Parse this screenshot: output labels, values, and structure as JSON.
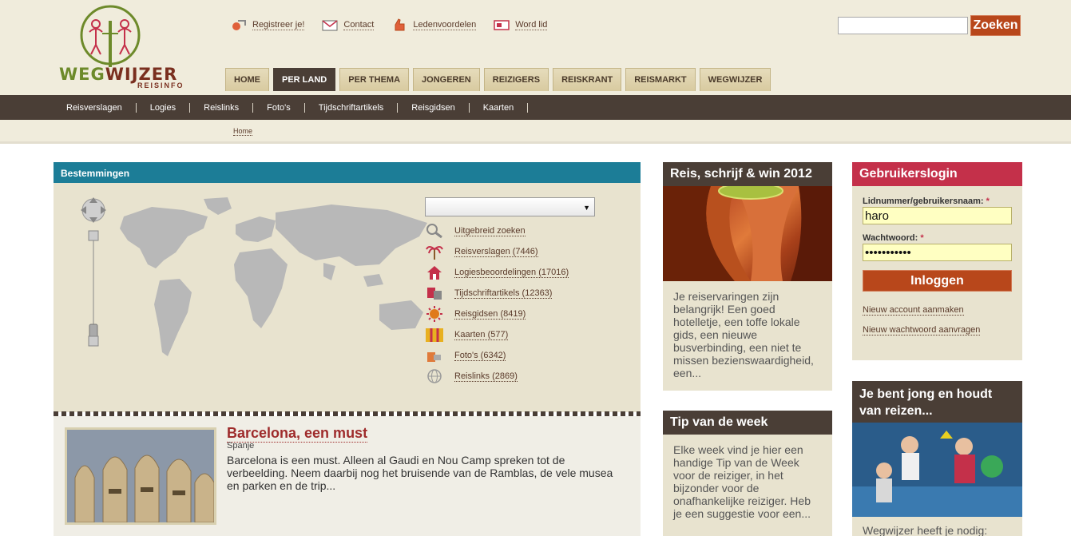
{
  "logo": {
    "word1": "WEG",
    "word2": "WIJZER",
    "sub": "REISINFO"
  },
  "toplinks": [
    {
      "label": "Registreer je!",
      "icon": "register-icon"
    },
    {
      "label": "Contact",
      "icon": "mail-icon"
    },
    {
      "label": "Ledenvoordelen",
      "icon": "thumb-icon"
    },
    {
      "label": "Word lid",
      "icon": "membership-icon"
    }
  ],
  "search": {
    "placeholder": "",
    "button": "Zoeken"
  },
  "mainnav": [
    "HOME",
    "PER LAND",
    "PER THEMA",
    "JONGEREN",
    "REIZIGERS",
    "REISKRANT",
    "REISMARKT",
    "WEGWIJZER"
  ],
  "mainnav_active": "PER LAND",
  "subnav": [
    "Reisverslagen",
    "Logies",
    "Reislinks",
    "Foto's",
    "Tijdschriftartikels",
    "Reisgidsen",
    "Kaarten"
  ],
  "breadcrumb": "Home",
  "destinations": {
    "title": "Bestemmingen",
    "select_value": "",
    "links": [
      {
        "label": "Uitgebreid zoeken",
        "icon": "magnifier-icon"
      },
      {
        "label": "Reisverslagen (7446)",
        "icon": "palm-tree-icon"
      },
      {
        "label": "Logiesbeoordelingen (17016)",
        "icon": "house-icon"
      },
      {
        "label": "Tijdschriftartikels (12363)",
        "icon": "magazine-icon"
      },
      {
        "label": "Reisgidsen (8419)",
        "icon": "sun-icon"
      },
      {
        "label": "Kaarten (577)",
        "icon": "map-icon"
      },
      {
        "label": "Foto's (6342)",
        "icon": "camera-icon"
      },
      {
        "label": "Reislinks (2869)",
        "icon": "globe-icon"
      }
    ]
  },
  "article": {
    "title": "Barcelona, een must",
    "country": "Spanje",
    "text": "Barcelona is een must. Alleen al Gaudi en Nou Camp spreken tot de verbeelding. Neem daarbij nog het bruisende van de Ramblas, de vele musea en parken en de trip..."
  },
  "reis_box": {
    "title": "Reis, schrijf & win 2012",
    "text": "Je reiservaringen zijn belangrijk! Een goed hotelletje, een toffe lokale gids, een nieuwe busverbinding, een niet te missen bezienswaardigheid, een..."
  },
  "tip_box": {
    "title": "Tip van de week",
    "text": "Elke week vind je hier een handige Tip van de Week voor de reiziger, in het bijzonder voor de onafhankelijke reiziger. Heb je een suggestie voor een..."
  },
  "login": {
    "title": "Gebruikerslogin",
    "username_label": "Lidnummer/gebruikersnaam:",
    "username_value": "haro",
    "password_label": "Wachtwoord:",
    "password_value": "•••••••••••",
    "required_mark": "*",
    "button": "Inloggen",
    "links": [
      "Nieuw account aanmaken",
      "Nieuw wachtwoord aanvragen"
    ]
  },
  "jong_box": {
    "title": "Je bent jong en houdt van reizen...",
    "text": "Wegwijzer heeft je nodig:"
  }
}
